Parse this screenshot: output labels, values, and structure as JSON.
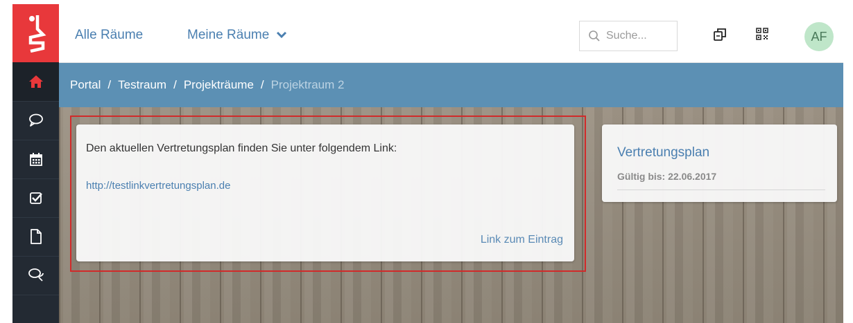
{
  "nav": {
    "all_rooms": "Alle Räume",
    "my_rooms": "Meine Räume"
  },
  "search": {
    "placeholder": "Suche..."
  },
  "user": {
    "initials": "AF"
  },
  "breadcrumb": {
    "items": [
      "Portal",
      "Testraum",
      "Projekträume"
    ],
    "current": "Projektraum 2",
    "separator": "/"
  },
  "post": {
    "text": "Den aktuellen Vertretungsplan finden Sie unter folgendem Link:",
    "url": "http://testlinkvertretungsplan.de",
    "entry_link": "Link zum Eintrag"
  },
  "side_card": {
    "title": "Vertretungsplan",
    "valid_until": "Gültig bis: 22.06.2017"
  },
  "sidebar": {
    "items": [
      "home-icon",
      "chat-bubble-icon",
      "calendar-icon",
      "checkbox-icon",
      "document-icon",
      "discussion-icon"
    ]
  },
  "colors": {
    "brand_red": "#e8383b",
    "sidebar": "#232a33",
    "breadcrumb_bar": "#5c90b4",
    "link_blue": "#4a7fb0",
    "highlight_red": "#d12a2a"
  }
}
